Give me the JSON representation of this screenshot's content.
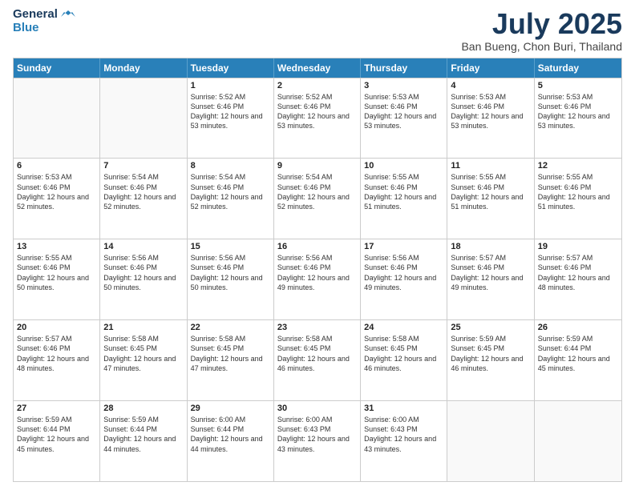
{
  "logo": {
    "line1": "General",
    "line2": "Blue"
  },
  "title": "July 2025",
  "location": "Ban Bueng, Chon Buri, Thailand",
  "days": [
    "Sunday",
    "Monday",
    "Tuesday",
    "Wednesday",
    "Thursday",
    "Friday",
    "Saturday"
  ],
  "weeks": [
    [
      {
        "day": "",
        "sunrise": "",
        "sunset": "",
        "daylight": ""
      },
      {
        "day": "",
        "sunrise": "",
        "sunset": "",
        "daylight": ""
      },
      {
        "day": "1",
        "sunrise": "Sunrise: 5:52 AM",
        "sunset": "Sunset: 6:46 PM",
        "daylight": "Daylight: 12 hours and 53 minutes."
      },
      {
        "day": "2",
        "sunrise": "Sunrise: 5:52 AM",
        "sunset": "Sunset: 6:46 PM",
        "daylight": "Daylight: 12 hours and 53 minutes."
      },
      {
        "day": "3",
        "sunrise": "Sunrise: 5:53 AM",
        "sunset": "Sunset: 6:46 PM",
        "daylight": "Daylight: 12 hours and 53 minutes."
      },
      {
        "day": "4",
        "sunrise": "Sunrise: 5:53 AM",
        "sunset": "Sunset: 6:46 PM",
        "daylight": "Daylight: 12 hours and 53 minutes."
      },
      {
        "day": "5",
        "sunrise": "Sunrise: 5:53 AM",
        "sunset": "Sunset: 6:46 PM",
        "daylight": "Daylight: 12 hours and 53 minutes."
      }
    ],
    [
      {
        "day": "6",
        "sunrise": "Sunrise: 5:53 AM",
        "sunset": "Sunset: 6:46 PM",
        "daylight": "Daylight: 12 hours and 52 minutes."
      },
      {
        "day": "7",
        "sunrise": "Sunrise: 5:54 AM",
        "sunset": "Sunset: 6:46 PM",
        "daylight": "Daylight: 12 hours and 52 minutes."
      },
      {
        "day": "8",
        "sunrise": "Sunrise: 5:54 AM",
        "sunset": "Sunset: 6:46 PM",
        "daylight": "Daylight: 12 hours and 52 minutes."
      },
      {
        "day": "9",
        "sunrise": "Sunrise: 5:54 AM",
        "sunset": "Sunset: 6:46 PM",
        "daylight": "Daylight: 12 hours and 52 minutes."
      },
      {
        "day": "10",
        "sunrise": "Sunrise: 5:55 AM",
        "sunset": "Sunset: 6:46 PM",
        "daylight": "Daylight: 12 hours and 51 minutes."
      },
      {
        "day": "11",
        "sunrise": "Sunrise: 5:55 AM",
        "sunset": "Sunset: 6:46 PM",
        "daylight": "Daylight: 12 hours and 51 minutes."
      },
      {
        "day": "12",
        "sunrise": "Sunrise: 5:55 AM",
        "sunset": "Sunset: 6:46 PM",
        "daylight": "Daylight: 12 hours and 51 minutes."
      }
    ],
    [
      {
        "day": "13",
        "sunrise": "Sunrise: 5:55 AM",
        "sunset": "Sunset: 6:46 PM",
        "daylight": "Daylight: 12 hours and 50 minutes."
      },
      {
        "day": "14",
        "sunrise": "Sunrise: 5:56 AM",
        "sunset": "Sunset: 6:46 PM",
        "daylight": "Daylight: 12 hours and 50 minutes."
      },
      {
        "day": "15",
        "sunrise": "Sunrise: 5:56 AM",
        "sunset": "Sunset: 6:46 PM",
        "daylight": "Daylight: 12 hours and 50 minutes."
      },
      {
        "day": "16",
        "sunrise": "Sunrise: 5:56 AM",
        "sunset": "Sunset: 6:46 PM",
        "daylight": "Daylight: 12 hours and 49 minutes."
      },
      {
        "day": "17",
        "sunrise": "Sunrise: 5:56 AM",
        "sunset": "Sunset: 6:46 PM",
        "daylight": "Daylight: 12 hours and 49 minutes."
      },
      {
        "day": "18",
        "sunrise": "Sunrise: 5:57 AM",
        "sunset": "Sunset: 6:46 PM",
        "daylight": "Daylight: 12 hours and 49 minutes."
      },
      {
        "day": "19",
        "sunrise": "Sunrise: 5:57 AM",
        "sunset": "Sunset: 6:46 PM",
        "daylight": "Daylight: 12 hours and 48 minutes."
      }
    ],
    [
      {
        "day": "20",
        "sunrise": "Sunrise: 5:57 AM",
        "sunset": "Sunset: 6:46 PM",
        "daylight": "Daylight: 12 hours and 48 minutes."
      },
      {
        "day": "21",
        "sunrise": "Sunrise: 5:58 AM",
        "sunset": "Sunset: 6:45 PM",
        "daylight": "Daylight: 12 hours and 47 minutes."
      },
      {
        "day": "22",
        "sunrise": "Sunrise: 5:58 AM",
        "sunset": "Sunset: 6:45 PM",
        "daylight": "Daylight: 12 hours and 47 minutes."
      },
      {
        "day": "23",
        "sunrise": "Sunrise: 5:58 AM",
        "sunset": "Sunset: 6:45 PM",
        "daylight": "Daylight: 12 hours and 46 minutes."
      },
      {
        "day": "24",
        "sunrise": "Sunrise: 5:58 AM",
        "sunset": "Sunset: 6:45 PM",
        "daylight": "Daylight: 12 hours and 46 minutes."
      },
      {
        "day": "25",
        "sunrise": "Sunrise: 5:59 AM",
        "sunset": "Sunset: 6:45 PM",
        "daylight": "Daylight: 12 hours and 46 minutes."
      },
      {
        "day": "26",
        "sunrise": "Sunrise: 5:59 AM",
        "sunset": "Sunset: 6:44 PM",
        "daylight": "Daylight: 12 hours and 45 minutes."
      }
    ],
    [
      {
        "day": "27",
        "sunrise": "Sunrise: 5:59 AM",
        "sunset": "Sunset: 6:44 PM",
        "daylight": "Daylight: 12 hours and 45 minutes."
      },
      {
        "day": "28",
        "sunrise": "Sunrise: 5:59 AM",
        "sunset": "Sunset: 6:44 PM",
        "daylight": "Daylight: 12 hours and 44 minutes."
      },
      {
        "day": "29",
        "sunrise": "Sunrise: 6:00 AM",
        "sunset": "Sunset: 6:44 PM",
        "daylight": "Daylight: 12 hours and 44 minutes."
      },
      {
        "day": "30",
        "sunrise": "Sunrise: 6:00 AM",
        "sunset": "Sunset: 6:43 PM",
        "daylight": "Daylight: 12 hours and 43 minutes."
      },
      {
        "day": "31",
        "sunrise": "Sunrise: 6:00 AM",
        "sunset": "Sunset: 6:43 PM",
        "daylight": "Daylight: 12 hours and 43 minutes."
      },
      {
        "day": "",
        "sunrise": "",
        "sunset": "",
        "daylight": ""
      },
      {
        "day": "",
        "sunrise": "",
        "sunset": "",
        "daylight": ""
      }
    ]
  ]
}
